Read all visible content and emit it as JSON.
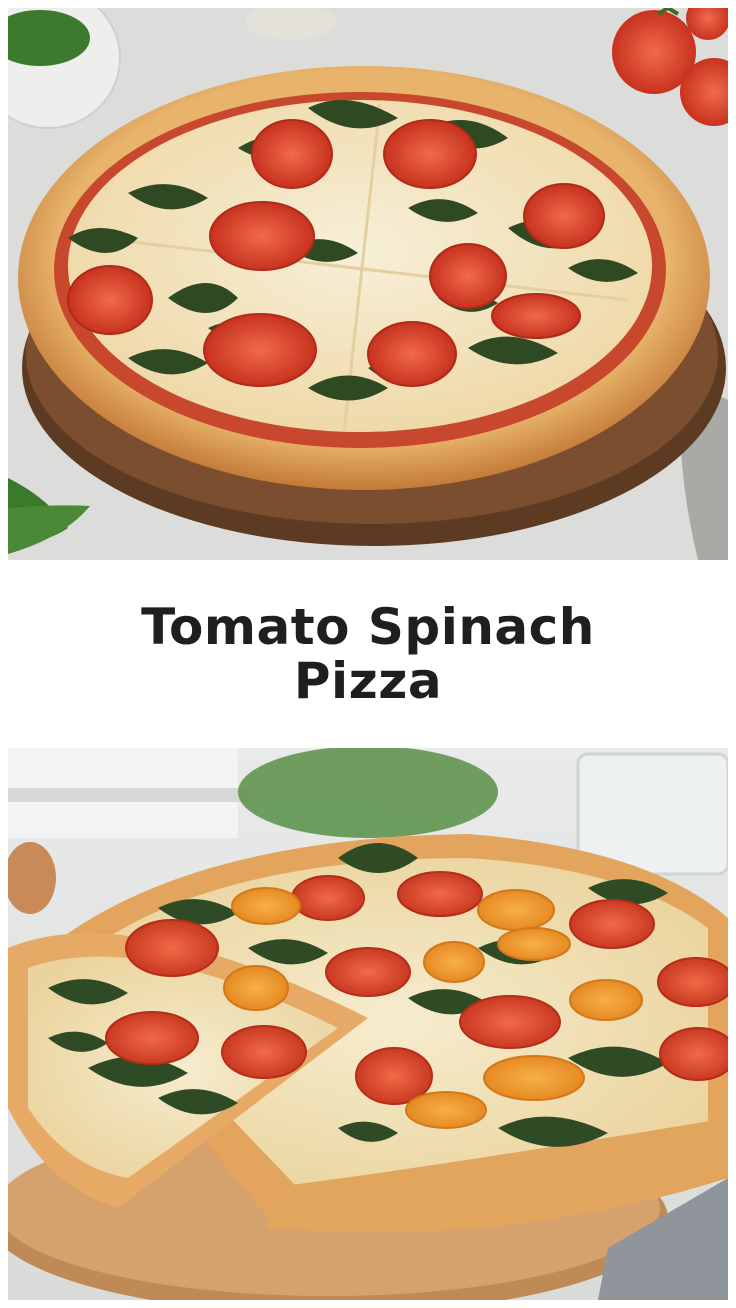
{
  "title": "Tomato Spinach Pizza",
  "images": {
    "top": {
      "subject": "pizza-on-board-icon"
    },
    "bottom": {
      "subject": "pizza-slice-pulled-icon"
    }
  },
  "colors": {
    "background": "#ffffff",
    "title_text": "#1f1f1f",
    "crust": "#d99a52",
    "cheese": "#f3e6c4",
    "tomato": "#d8402a",
    "spinach": "#2f4a22",
    "board": "#6b4428"
  }
}
